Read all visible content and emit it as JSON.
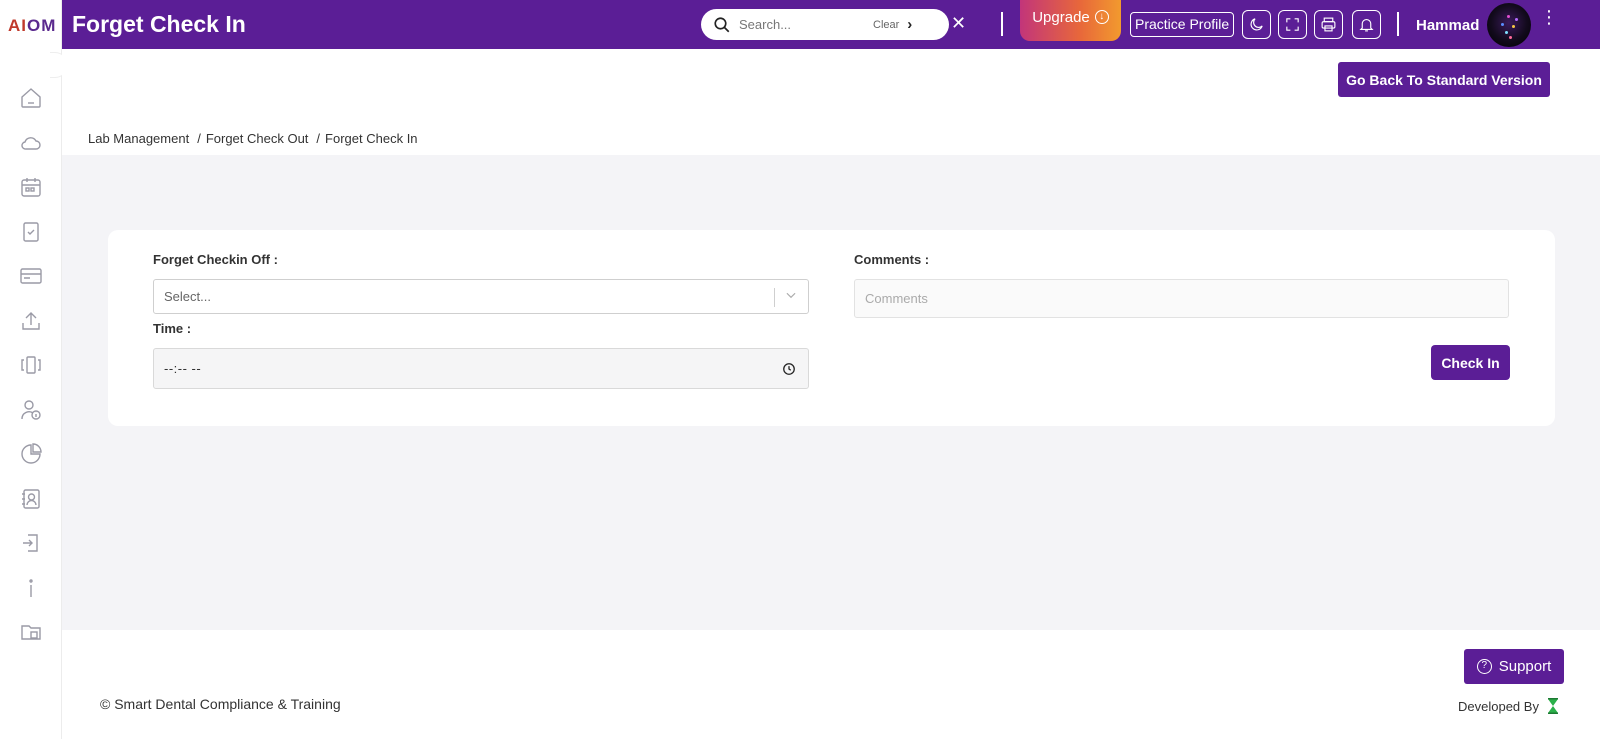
{
  "app": {
    "logo_left": "AI",
    "logo_right": "OM"
  },
  "topbar": {
    "title": "Forget Check In",
    "search_placeholder": "Search...",
    "clear_label": "Clear",
    "go_symbol": "›",
    "close_symbol": "✕",
    "upgrade_label": "Upgrade",
    "practice_profile_label": "Practice Profile",
    "user_name": "Hammad",
    "menu_symbol": "⋮"
  },
  "header": {
    "go_back_label": "Go Back To Standard Version",
    "breadcrumb": [
      "Lab Management",
      "Forget Check Out",
      "Forget Check In"
    ],
    "breadcrumb_separator": "/"
  },
  "form": {
    "checkin_off_label": "Forget Checkin Off :",
    "checkin_off_placeholder": "Select...",
    "time_label": "Time :",
    "time_value": "--:-- --",
    "comments_label": "Comments :",
    "comments_placeholder": "Comments",
    "checkin_button": "Check In"
  },
  "footer": {
    "support_label": "Support",
    "copyright": "© Smart Dental Compliance & Training",
    "developed_by": "Developed By"
  },
  "colors": {
    "brand": "#5b1e96",
    "upgrade_gradient": [
      "#c2357a",
      "#e8683a",
      "#f29a2e"
    ],
    "page_bg": "#f4f4f7"
  },
  "icons": {
    "sidebar": [
      "home-icon",
      "cloud-icon",
      "calendar-icon",
      "clipboard-check-icon",
      "card-icon",
      "upload-icon",
      "columns-icon",
      "user-info-icon",
      "pie-chart-icon",
      "contacts-icon",
      "sign-in-icon",
      "info-icon",
      "folder-icon"
    ],
    "topbar": [
      "search-icon",
      "moon-icon",
      "fullscreen-icon",
      "printer-icon",
      "bell-icon"
    ]
  }
}
